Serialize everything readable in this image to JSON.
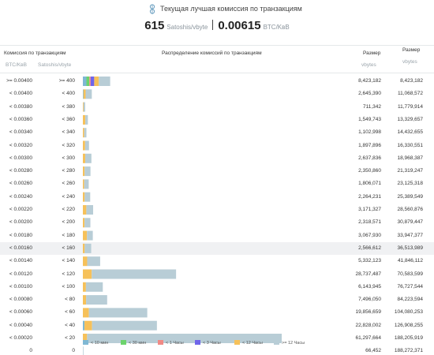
{
  "header": {
    "title": "Текущая лучшая комиссия по транзакциям",
    "fee_sat": "615",
    "fee_sat_unit": "Satoshis/vbyte",
    "fee_btc": "0.00615",
    "fee_btc_unit": "BTC/KвB"
  },
  "table": {
    "col_fee": "Комиссия по транзакциям",
    "col_fee_btc": "BTC/KвB",
    "col_fee_sat": "Satoshis/vbyte",
    "col_dist": "Распределение комиссий по транзакциям",
    "col_size": "Размер",
    "col_size_unit": "vbytes",
    "col_size2": "Размер",
    "col_size2_unit": "vbytes"
  },
  "colors": {
    "lt10min": "#7fb8d4",
    "lt30min": "#6cd36c",
    "lt1h": "#f08a85",
    "lt3h": "#6f65ea",
    "lt12h": "#f6c15a",
    "ge12h": "#b8cdd6",
    "row_highlight": "#f0f1f3"
  },
  "legend": [
    {
      "label": "< 10 мин",
      "color": "#7fb8d4"
    },
    {
      "label": "< 30 мин",
      "color": "#6cd36c"
    },
    {
      "label": "< 1 Часы",
      "color": "#f08a85"
    },
    {
      "label": "< 3 Часы",
      "color": "#6f65ea"
    },
    {
      "label": "< 12 Часы",
      "color": "#f6c15a"
    },
    {
      "label": ">= 12 Часы",
      "color": "#b8cdd6"
    }
  ],
  "chart_data": {
    "type": "bar",
    "orientation": "horizontal",
    "stacked": true,
    "title": "Распределение комиссий по транзакциям",
    "highlighted_row": 13,
    "series_names": [
      "< 10 мин",
      "< 30 мин",
      "< 1 Часы",
      "< 3 Часы",
      "< 12 Часы",
      ">= 12 Часы"
    ],
    "rows": [
      {
        "btc": ">= 0.00400",
        "sat": ">= 400",
        "size": "8,423,182",
        "cum": "8,423,182",
        "segments": [
          1100000,
          900000,
          400000,
          1100000,
          1400000,
          3523182
        ]
      },
      {
        "btc": "< 0.00400",
        "sat": "< 400",
        "size": "2,645,390",
        "cum": "11,068,572",
        "segments": [
          80000,
          0,
          0,
          0,
          665390,
          1900000
        ]
      },
      {
        "btc": "< 0.00380",
        "sat": "< 380",
        "size": "711,342",
        "cum": "11,779,914",
        "segments": [
          0,
          0,
          0,
          0,
          211342,
          500000
        ]
      },
      {
        "btc": "< 0.00360",
        "sat": "< 360",
        "size": "1,549,743",
        "cum": "13,329,657",
        "segments": [
          0,
          0,
          0,
          0,
          749743,
          800000
        ]
      },
      {
        "btc": "< 0.00340",
        "sat": "< 340",
        "size": "1,102,998",
        "cum": "14,432,655",
        "segments": [
          0,
          0,
          0,
          0,
          402998,
          700000
        ]
      },
      {
        "btc": "< 0.00320",
        "sat": "< 320",
        "size": "1,897,896",
        "cum": "16,330,551",
        "segments": [
          0,
          0,
          0,
          0,
          697896,
          1200000
        ]
      },
      {
        "btc": "< 0.00300",
        "sat": "< 300",
        "size": "2,637,836",
        "cum": "18,968,387",
        "segments": [
          0,
          0,
          0,
          0,
          737836,
          1900000
        ]
      },
      {
        "btc": "< 0.00280",
        "sat": "< 280",
        "size": "2,350,860",
        "cum": "21,319,247",
        "segments": [
          0,
          0,
          0,
          0,
          550860,
          1800000
        ]
      },
      {
        "btc": "< 0.00260",
        "sat": "< 260",
        "size": "1,806,071",
        "cum": "23,125,318",
        "segments": [
          0,
          0,
          0,
          0,
          406071,
          1400000
        ]
      },
      {
        "btc": "< 0.00240",
        "sat": "< 240",
        "size": "2,264,231",
        "cum": "25,389,549",
        "segments": [
          0,
          0,
          0,
          0,
          564231,
          1700000
        ]
      },
      {
        "btc": "< 0.00220",
        "sat": "< 220",
        "size": "3,171,327",
        "cum": "28,560,876",
        "segments": [
          0,
          0,
          0,
          0,
          1071327,
          2100000
        ]
      },
      {
        "btc": "< 0.00200",
        "sat": "< 200",
        "size": "2,318,571",
        "cum": "30,879,447",
        "segments": [
          0,
          0,
          0,
          0,
          518571,
          1800000
        ]
      },
      {
        "btc": "< 0.00180",
        "sat": "< 180",
        "size": "3,067,930",
        "cum": "33,947,377",
        "segments": [
          0,
          0,
          0,
          0,
          1267930,
          1800000
        ]
      },
      {
        "btc": "< 0.00160",
        "sat": "< 160",
        "size": "2,566,612",
        "cum": "36,513,989",
        "segments": [
          0,
          0,
          0,
          0,
          566612,
          2000000
        ]
      },
      {
        "btc": "< 0.00140",
        "sat": "< 140",
        "size": "5,332,123",
        "cum": "41,846,112",
        "segments": [
          0,
          0,
          0,
          0,
          1332123,
          4000000
        ]
      },
      {
        "btc": "< 0.00120",
        "sat": "< 120",
        "size": "28,737,487",
        "cum": "70,583,599",
        "segments": [
          0,
          0,
          0,
          0,
          2737487,
          26000000
        ]
      },
      {
        "btc": "< 0.00100",
        "sat": "< 100",
        "size": "6,143,945",
        "cum": "76,727,544",
        "segments": [
          0,
          0,
          0,
          0,
          943945,
          5200000
        ]
      },
      {
        "btc": "< 0.00080",
        "sat": "< 80",
        "size": "7,496,050",
        "cum": "84,223,594",
        "segments": [
          0,
          0,
          0,
          0,
          996050,
          6500000
        ]
      },
      {
        "btc": "< 0.00060",
        "sat": "< 60",
        "size": "19,856,659",
        "cum": "104,080,253",
        "segments": [
          0,
          0,
          0,
          0,
          1856659,
          18000000
        ]
      },
      {
        "btc": "< 0.00040",
        "sat": "< 40",
        "size": "22,828,002",
        "cum": "126,908,255",
        "segments": [
          500000,
          0,
          0,
          0,
          2328002,
          20000000
        ]
      },
      {
        "btc": "< 0.00020",
        "sat": "< 20",
        "size": "61,297,664",
        "cum": "188,205,919",
        "segments": [
          0,
          0,
          0,
          0,
          1297664,
          60000000
        ]
      },
      {
        "btc": "0",
        "sat": "0",
        "size": "66,452",
        "cum": "188,272,371",
        "segments": [
          0,
          0,
          0,
          0,
          0,
          66452
        ]
      }
    ]
  }
}
